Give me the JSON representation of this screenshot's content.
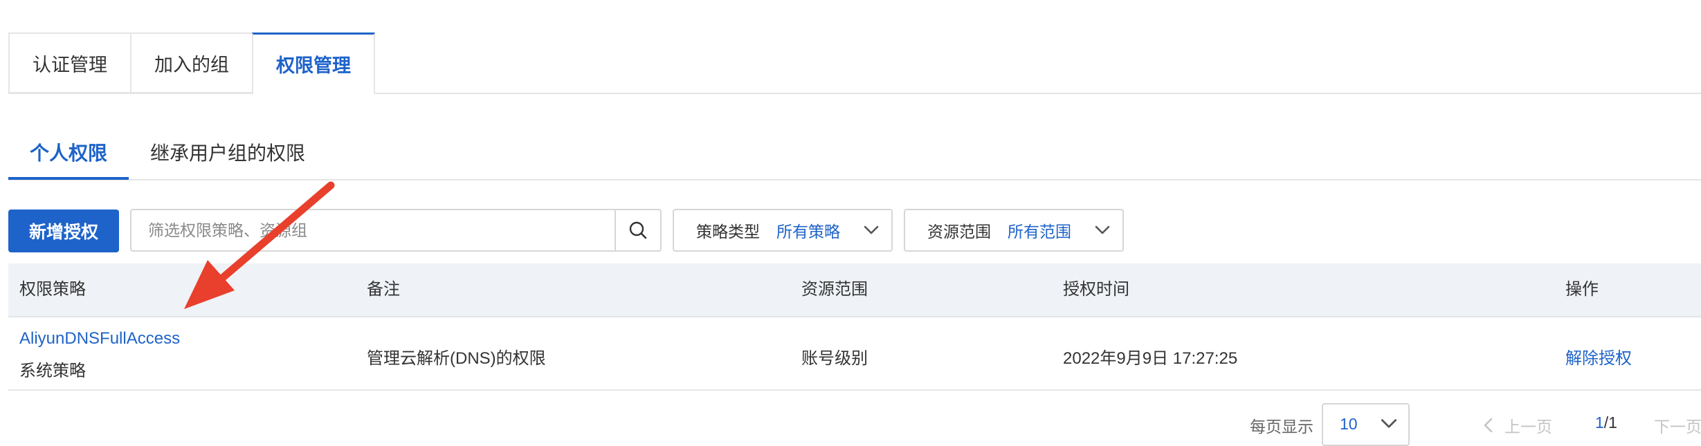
{
  "top_tabs": [
    {
      "label": "认证管理"
    },
    {
      "label": "加入的组"
    },
    {
      "label": "权限管理"
    }
  ],
  "sub_tabs": [
    {
      "label": "个人权限"
    },
    {
      "label": "继承用户组的权限"
    }
  ],
  "toolbar": {
    "add_button": "新增授权",
    "search_placeholder": "筛选权限策略、资源组",
    "policy_type": {
      "label": "策略类型",
      "value": "所有策略"
    },
    "resource_scope": {
      "label": "资源范围",
      "value": "所有范围"
    }
  },
  "table": {
    "headers": {
      "policy": "权限策略",
      "note": "备注",
      "scope": "资源范围",
      "time": "授权时间",
      "action": "操作"
    },
    "rows": [
      {
        "policy_name": "AliyunDNSFullAccess",
        "policy_type": "系统策略",
        "note": "管理云解析(DNS)的权限",
        "scope": "账号级别",
        "time": "2022年9月9日 17:27:25",
        "action": "解除授权"
      }
    ]
  },
  "pagination": {
    "per_page_label": "每页显示",
    "per_page_value": "10",
    "prev": "上一页",
    "current": "1",
    "total": "/1",
    "next": "下一页"
  },
  "colors": {
    "accent": "#1e63c9",
    "arrow": "#e8402c"
  }
}
